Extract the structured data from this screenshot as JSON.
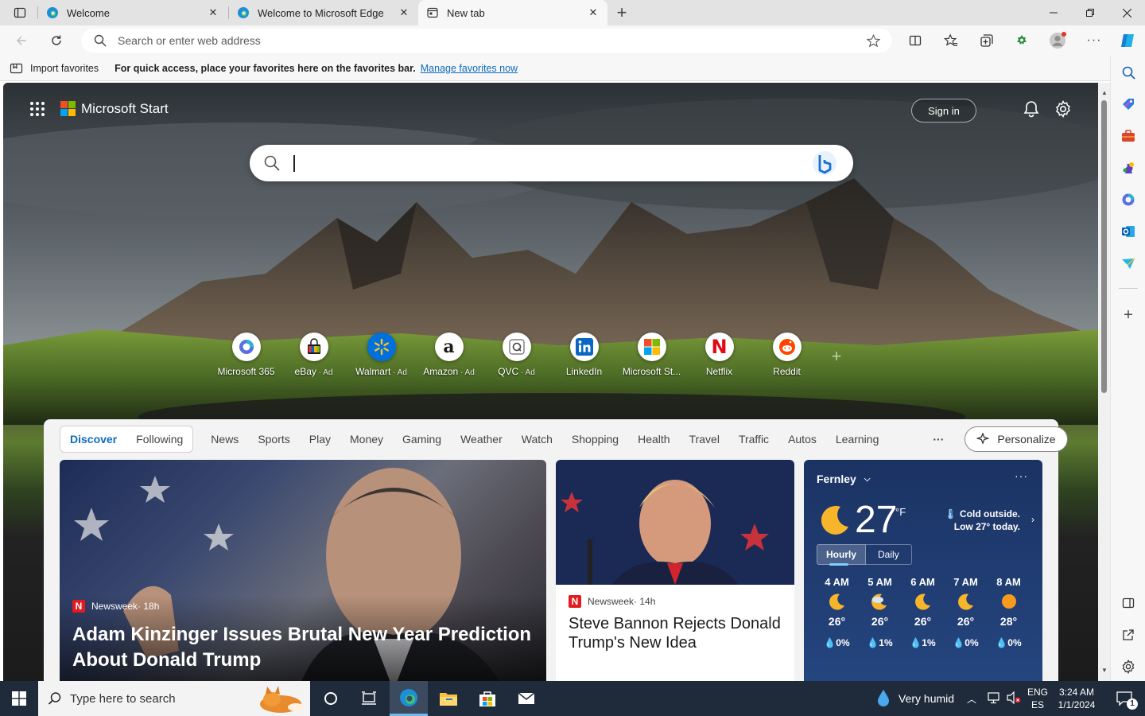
{
  "browser": {
    "tabs": [
      {
        "title": "Welcome",
        "icon": "edge-icon"
      },
      {
        "title": "Welcome to Microsoft Edge",
        "icon": "edge-icon"
      },
      {
        "title": "New tab",
        "icon": "newtab-icon"
      }
    ],
    "address": {
      "placeholder": "Search or enter web address"
    },
    "favorites_bar": {
      "import_label": "Import favorites",
      "message": "For quick access, place your favorites here on the favorites bar.",
      "link": "Manage favorites now"
    }
  },
  "page": {
    "brand": "Microsoft Start",
    "sign_in": "Sign in",
    "quick_links": [
      {
        "label": "Microsoft 365",
        "ad": "",
        "icon": "m365-icon"
      },
      {
        "label": "eBay",
        "ad": " · Ad",
        "icon": "ebay-icon"
      },
      {
        "label": "Walmart",
        "ad": " · Ad",
        "icon": "walmart-icon"
      },
      {
        "label": "Amazon",
        "ad": " · Ad",
        "icon": "amazon-icon"
      },
      {
        "label": "QVC",
        "ad": " · Ad",
        "icon": "qvc-icon"
      },
      {
        "label": "LinkedIn",
        "ad": "",
        "icon": "linkedin-icon"
      },
      {
        "label": "Microsoft St...",
        "ad": "",
        "icon": "msstore-icon"
      },
      {
        "label": "Netflix",
        "ad": "",
        "icon": "netflix-icon"
      },
      {
        "label": "Reddit",
        "ad": "",
        "icon": "reddit-icon"
      }
    ],
    "feed_nav": {
      "discover": "Discover",
      "following": "Following",
      "items": [
        "News",
        "Sports",
        "Play",
        "Money",
        "Gaming",
        "Weather",
        "Watch",
        "Shopping",
        "Health",
        "Travel",
        "Traffic",
        "Autos",
        "Learning"
      ],
      "more": "···",
      "personalize": "Personalize"
    },
    "cards": {
      "main": {
        "source": "Newsweek",
        "age": " · 18h",
        "headline": "Adam Kinzinger Issues Brutal New Year Prediction About Donald Trump"
      },
      "second": {
        "source": "Newsweek",
        "age": " · 14h",
        "headline": "Steve Bannon Rejects Donald Trump's New Idea"
      }
    },
    "weather": {
      "location": "Fernley",
      "temp": "27",
      "unit": "°F",
      "summary": "Cold outside. Low 27° today.",
      "tabs": [
        "Hourly",
        "Daily"
      ],
      "hours": [
        {
          "time": "4 AM",
          "temp": "26°",
          "precip": "0%",
          "icon": "moon-icon"
        },
        {
          "time": "5 AM",
          "temp": "26°",
          "precip": "1%",
          "icon": "moon-cloud-icon"
        },
        {
          "time": "6 AM",
          "temp": "26°",
          "precip": "1%",
          "icon": "moon-icon"
        },
        {
          "time": "7 AM",
          "temp": "26°",
          "precip": "0%",
          "icon": "moon-icon"
        },
        {
          "time": "8 AM",
          "temp": "28°",
          "precip": "0%",
          "icon": "sun-icon"
        }
      ]
    }
  },
  "taskbar": {
    "search_placeholder": "Type here to search",
    "weather": "Very humid",
    "lang1": "ENG",
    "lang2": "ES",
    "time": "3:24 AM",
    "date": "1/1/2024",
    "notif_count": "1"
  },
  "colors": {
    "accent": "#0f6cbd",
    "taskbar": "#1f2b3a",
    "weather_card": "#1e3a6e"
  }
}
